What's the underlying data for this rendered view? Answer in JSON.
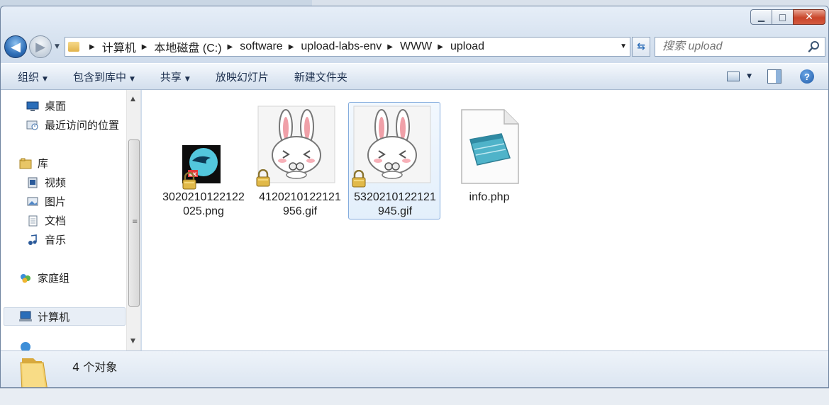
{
  "address": {
    "crumbs": [
      "计算机",
      "本地磁盘 (C:)",
      "software",
      "upload-labs-env",
      "WWW",
      "upload"
    ]
  },
  "search": {
    "placeholder": "搜索 upload"
  },
  "toolbar": {
    "organize": "组织",
    "include_in_library": "包含到库中",
    "share": "共享",
    "slideshow": "放映幻灯片",
    "new_folder": "新建文件夹"
  },
  "nav": {
    "desktop": "桌面",
    "recent": "最近访问的位置",
    "libraries": "库",
    "videos": "视频",
    "pictures": "图片",
    "documents": "文档",
    "music": "音乐",
    "homegroup": "家庭组",
    "computer": "计算机"
  },
  "files": [
    {
      "name": "3020210122122025.png",
      "type": "png",
      "locked": true,
      "selected": false
    },
    {
      "name": "4120210122121956.gif",
      "type": "gif",
      "locked": true,
      "selected": false
    },
    {
      "name": "5320210122121945.gif",
      "type": "gif",
      "locked": true,
      "selected": true
    },
    {
      "name": "info.php",
      "type": "php",
      "locked": false,
      "selected": false
    }
  ],
  "details": {
    "count_text": "4 个对象"
  },
  "thumb_badge": "BK",
  "colors": {
    "selection_border": "#84acdd",
    "accent_blue": "#2f6fb8",
    "close_red": "#c9452a"
  }
}
